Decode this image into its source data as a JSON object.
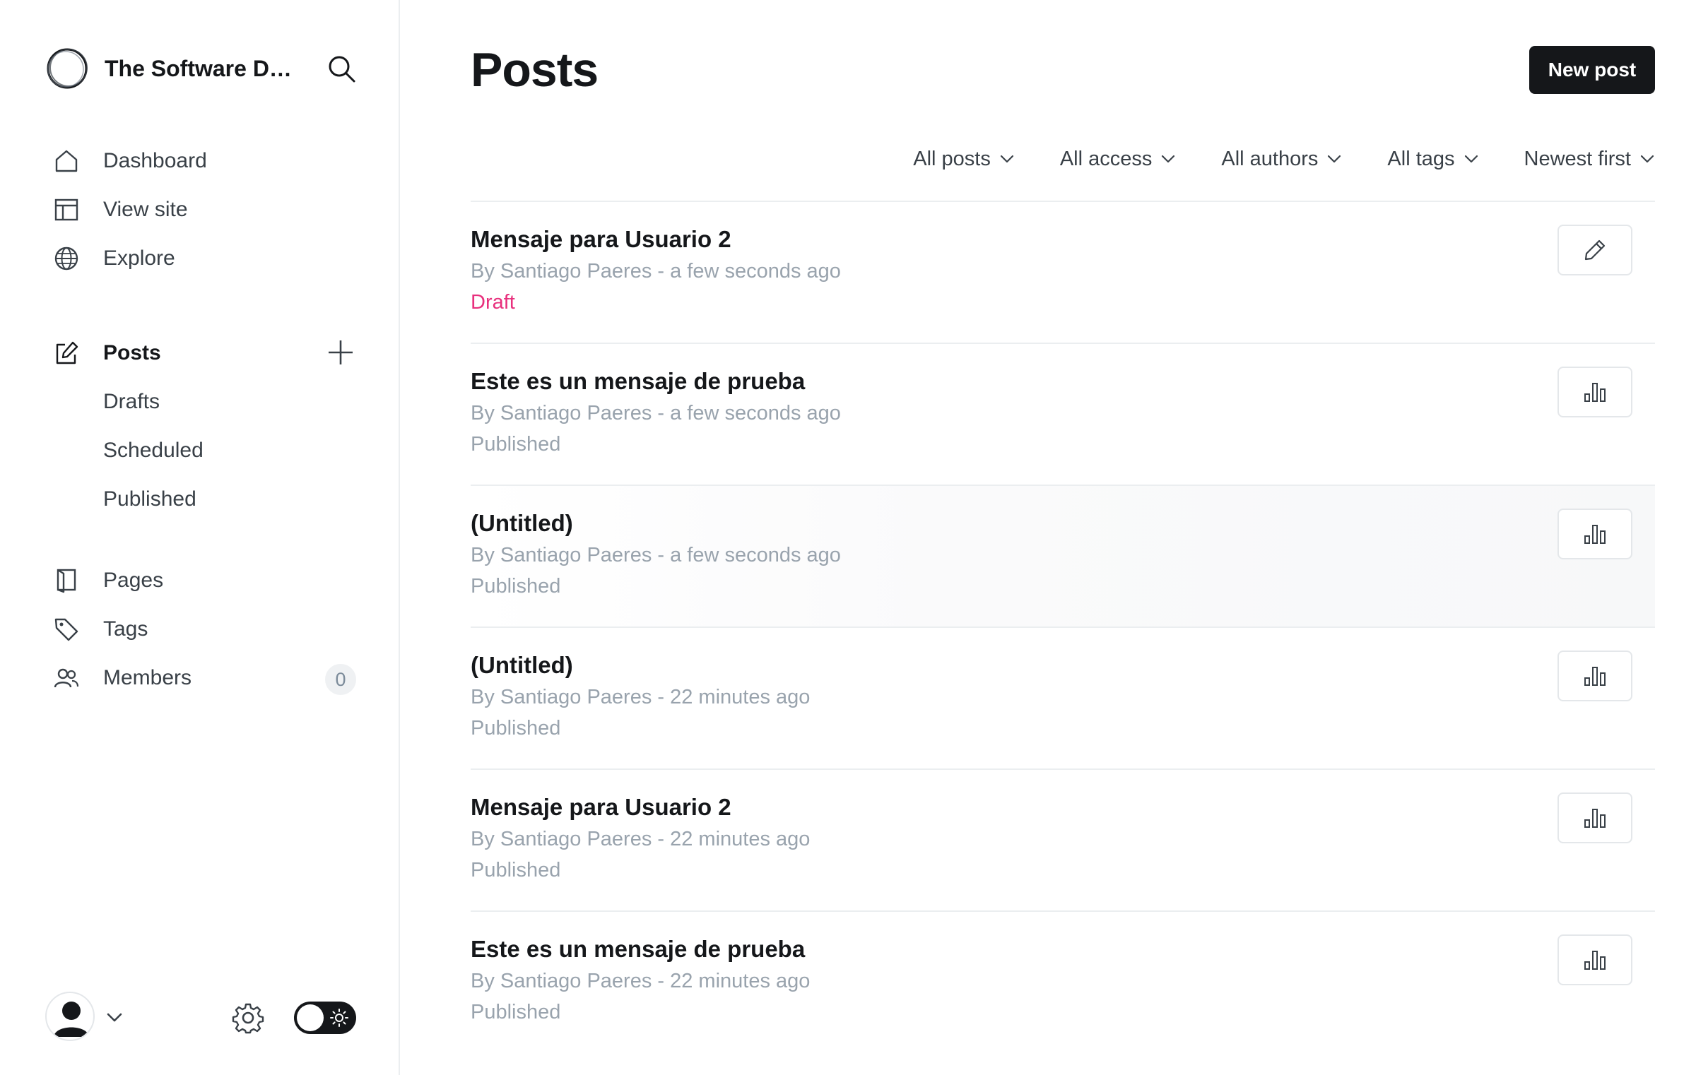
{
  "sidebar": {
    "site_title": "The Software De...",
    "nav": {
      "dashboard": "Dashboard",
      "view_site": "View site",
      "explore": "Explore",
      "posts": "Posts",
      "drafts": "Drafts",
      "scheduled": "Scheduled",
      "published": "Published",
      "pages": "Pages",
      "tags": "Tags",
      "members": "Members",
      "members_count": "0"
    }
  },
  "header": {
    "title": "Posts",
    "new_post_label": "New post"
  },
  "filters": {
    "type": "All posts",
    "access": "All access",
    "authors": "All authors",
    "tags": "All tags",
    "order": "Newest first"
  },
  "posts": [
    {
      "title": "Mensaje para Usuario 2",
      "meta": "By Santiago Paeres - a few seconds ago",
      "status": "Draft",
      "action": "edit-icon"
    },
    {
      "title": "Este es un mensaje de prueba",
      "meta": "By Santiago Paeres - a few seconds ago",
      "status": "Published",
      "action": "analytics-icon"
    },
    {
      "title": "(Untitled)",
      "meta": "By Santiago Paeres - a few seconds ago",
      "status": "Published",
      "action": "analytics-icon"
    },
    {
      "title": "(Untitled)",
      "meta": "By Santiago Paeres - 22 minutes ago",
      "status": "Published",
      "action": "analytics-icon"
    },
    {
      "title": "Mensaje para Usuario 2",
      "meta": "By Santiago Paeres - 22 minutes ago",
      "status": "Published",
      "action": "analytics-icon"
    },
    {
      "title": "Este es un mensaje de prueba",
      "meta": "By Santiago Paeres - 22 minutes ago",
      "status": "Published",
      "action": "analytics-icon"
    }
  ],
  "colors": {
    "accent_dark": "#15171a",
    "draft_status": "#e8307d",
    "muted_text": "#99a3ad"
  }
}
